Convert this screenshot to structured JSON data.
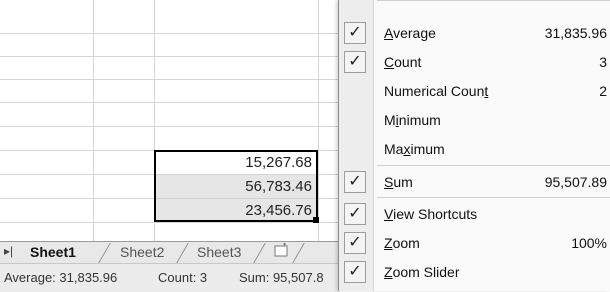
{
  "sheet": {
    "cells": [
      "15,267.68",
      "56,783.46",
      "23,456.76"
    ]
  },
  "tabs": {
    "nav_icon": "last-sheet-icon",
    "items": [
      "Sheet1",
      "Sheet2",
      "Sheet3"
    ],
    "insert_icon": "insert-worksheet-icon"
  },
  "status": {
    "average": "Average: 31,835.96",
    "count": "Count: 3",
    "sum": "Sum: 95,507.8"
  },
  "menu": {
    "items": [
      {
        "pre": "",
        "acc": "A",
        "post": "verage",
        "value": "31,835.96",
        "checked": true
      },
      {
        "pre": "",
        "acc": "C",
        "post": "ount",
        "value": "3",
        "checked": true
      },
      {
        "pre": "Numerical Coun",
        "acc": "t",
        "post": "",
        "value": "2",
        "checked": false
      },
      {
        "pre": "M",
        "acc": "i",
        "post": "nimum",
        "value": "",
        "checked": false
      },
      {
        "pre": "Ma",
        "acc": "x",
        "post": "imum",
        "value": "",
        "checked": false
      },
      {
        "pre": "",
        "acc": "S",
        "post": "um",
        "value": "95,507.89",
        "checked": true
      },
      {
        "pre": "",
        "acc": "V",
        "post": "iew Shortcuts",
        "value": "",
        "checked": true
      },
      {
        "pre": "",
        "acc": "Z",
        "post": "oom",
        "value": "100%",
        "checked": true
      },
      {
        "pre": "",
        "acc": "Z",
        "post": "oom Slider",
        "value": "",
        "checked": true
      }
    ],
    "check_glyph": "✓"
  }
}
